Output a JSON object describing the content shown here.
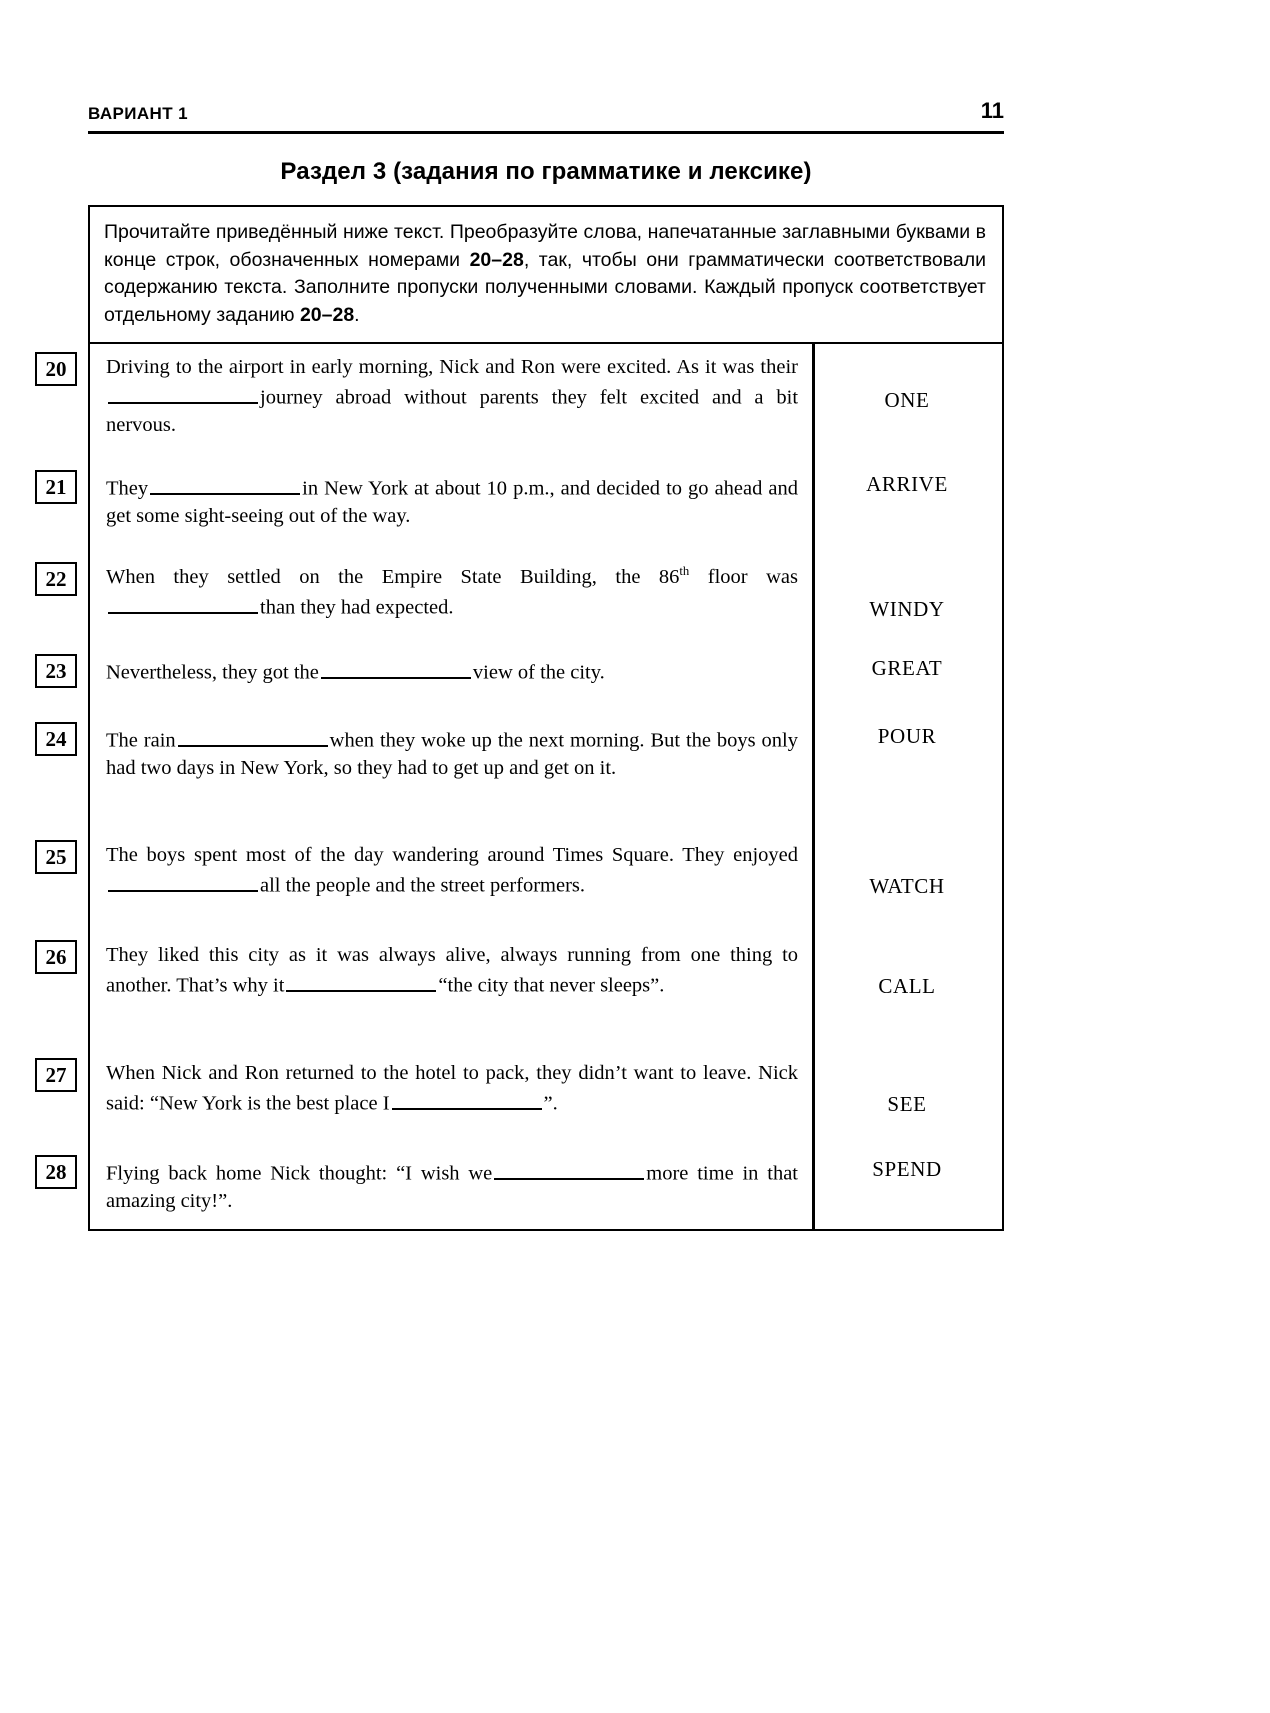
{
  "header": {
    "variant_label": "ВАРИАНТ 1",
    "page_number": "11"
  },
  "section": {
    "title": "Раздел 3 (задания по грамматике и лексике)"
  },
  "instruction": {
    "part1": "Прочитайте приведённый ниже текст. Преобразуйте слова, напечатанные заглавными буквами в конце строк, обозначенных номерами ",
    "range1": "20–28",
    "part2": ", так, чтобы они грамматически соответствовали содержанию текста. Заполните пропуски полученными словами. Каждый пропуск соответствует отдельному заданию ",
    "range2": "20–28",
    "part3": "."
  },
  "tasks": [
    {
      "number": "20",
      "word": "ONE",
      "line1_a": "Driving to the airport in early morning, Nick and Ron were excited.",
      "line2_a": "As it was their",
      "line2_b": "journey abroad without parents they",
      "line3": "felt excited and a bit nervous."
    },
    {
      "number": "21",
      "word": "ARRIVE",
      "line1_a": "They",
      "line1_b": "in New York at about 10 p.m., and decided to",
      "line2": "go ahead and get some sight-seeing out of the way."
    },
    {
      "number": "22",
      "word": "WINDY",
      "line1_a": "When they settled on the Empire State Building, the 86",
      "line1_sup": "th",
      "line1_b": " floor was",
      "line2_b": "than they had expected."
    },
    {
      "number": "23",
      "word": "GREAT",
      "line1_a": "Nevertheless, they got the",
      "line1_b": "view of the city."
    },
    {
      "number": "24",
      "word": "POUR",
      "line1_a": "The rain",
      "line1_b": "when they woke up the next morning. But",
      "line2": "the boys only had two days in New York, so they had to get up and",
      "line3": "get on it."
    },
    {
      "number": "25",
      "word": "WATCH",
      "line1_a": "The boys spent most of the day wandering around Times Square. They",
      "line2_a": "enjoyed",
      "line2_b": "all the people and the street performers."
    },
    {
      "number": "26",
      "word": "CALL",
      "line1_a": "They liked this city as it was always alive, always running from one",
      "line2_a": "thing to another. That’s why it",
      "line2_b": "“the city that never",
      "line3": "sleeps”."
    },
    {
      "number": "27",
      "word": "SEE",
      "line1_a": "When Nick and Ron returned to the hotel to pack, they didn’t want",
      "line2_a": "to leave. Nick said: “New York is the best place I",
      "line2_b": "”."
    },
    {
      "number": "28",
      "word": "SPEND",
      "line1_a": "Flying back home Nick thought: “I wish we",
      "line1_b": "more",
      "line2": "time in that amazing city!”."
    }
  ]
}
